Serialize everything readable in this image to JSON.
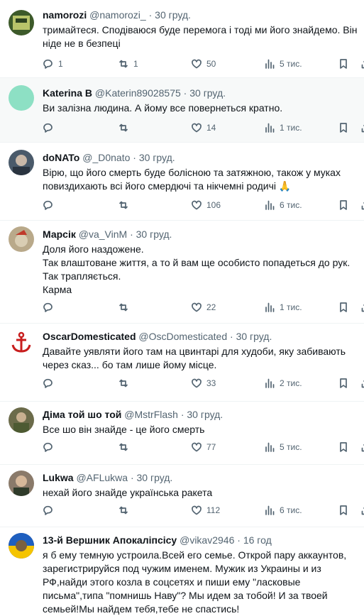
{
  "tweets": [
    {
      "name": "namorozi",
      "handle": "@namorozi_",
      "sep": "·",
      "date": "30 груд.",
      "text": "тримайтеся. Сподіваюся буде перемога і тоді ми його знайдемо. Він ніде не в безпеці",
      "replies": "1",
      "retweets": "1",
      "likes": "50",
      "views": "5 тис.",
      "avatar_color": "#3d5a2a"
    },
    {
      "name": "Katerina B",
      "handle": "@Katerin89028575",
      "sep": "·",
      "date": "30 груд.",
      "text": "Ви залізна людина. А йому все повернеться кратно.",
      "replies": "",
      "retweets": "",
      "likes": "14",
      "views": "1 тис.",
      "avatar_color": "#8de0c4"
    },
    {
      "name": "doNATo",
      "handle": "@_D0nato",
      "sep": "·",
      "date": "30 груд.",
      "text": "Вірю, що його смерть буде болісною та затяжною, також у муках повиздихають всі його смердючі та нікчемні родичі 🙏",
      "replies": "",
      "retweets": "",
      "likes": "106",
      "views": "6 тис.",
      "avatar_color": "#4a5a6a"
    },
    {
      "name": "Марсік",
      "handle": "@va_VinM",
      "sep": "·",
      "date": "30 груд.",
      "text": "Доля його наздожене.\nТак влаштоване життя, а то й вам ще особисто попадеться до рук.\nТак трапляється.\nКарма",
      "replies": "",
      "retweets": "",
      "likes": "22",
      "views": "1 тис.",
      "avatar_color": "#b9a98a"
    },
    {
      "name": "OscarDomesticated",
      "handle": "@OscDomesticated",
      "sep": "·",
      "date": "30 груд.",
      "text": "Давайте уявляти його там на цвинтарі для худоби, яку забивають через сказ... бо там лише йому місце.",
      "replies": "",
      "retweets": "",
      "likes": "33",
      "views": "2 тис.",
      "avatar_color": "#ffffff"
    },
    {
      "name": "Діма той шо той",
      "handle": "@MstrFlash",
      "sep": "·",
      "date": "30 груд.",
      "text": "Все шо він знайде - це його смерть",
      "replies": "",
      "retweets": "",
      "likes": "77",
      "views": "5 тис.",
      "avatar_color": "#6b6b4a"
    },
    {
      "name": "Lukwa",
      "handle": "@AFLukwa",
      "sep": "·",
      "date": "30 груд.",
      "text": "нехай його знайде українська ракета",
      "replies": "",
      "retweets": "",
      "likes": "112",
      "views": "6 тис.",
      "avatar_color": "#8a7a6a"
    },
    {
      "name": "13-й Вершник Апокаліпсісу",
      "handle": "@vikav2946",
      "sep": "·",
      "date": "16 год",
      "text": "я б ему темную устроила.Всей его семье. Открой пару аккаунтов, зарегистрируйся под чужим именем. Мужик из Украины и из РФ,найди этого козла в соцсетях и пиши ему \"ласковые письма\",типа \"помнишь Наву\"? Мы идем за тобой! И за твоей семьей!Мы найдем тебя,тебе не спастись!",
      "replies": "",
      "retweets": "",
      "likes": "",
      "views": "",
      "avatar_color": "#2a3f7a"
    }
  ]
}
